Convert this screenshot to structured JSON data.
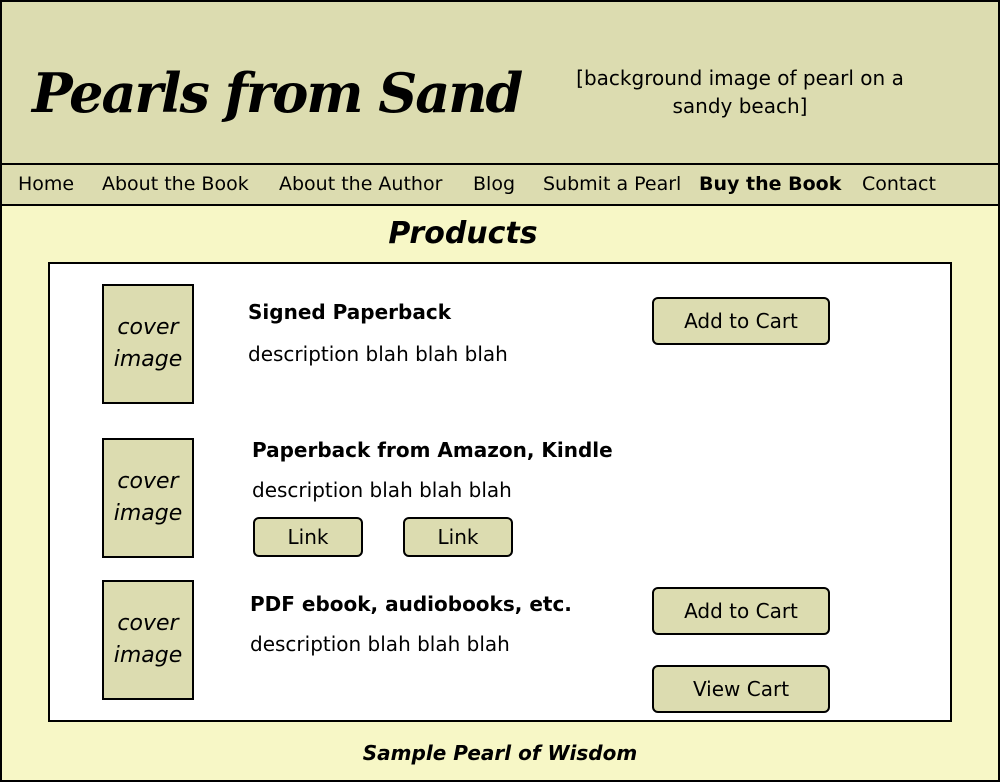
{
  "header": {
    "site_title": "Pearls from Sand",
    "background_note": "[background image of pearl on a sandy beach]"
  },
  "nav": {
    "items": [
      {
        "label": "Home"
      },
      {
        "label": "About the Book"
      },
      {
        "label": "About the Author"
      },
      {
        "label": "Blog"
      },
      {
        "label": "Submit a Pearl"
      },
      {
        "label": "Buy the Book",
        "active": true
      },
      {
        "label": "Contact"
      }
    ]
  },
  "main": {
    "heading": "Products",
    "products": [
      {
        "cover_text": "cover image",
        "title": "Signed Paperback",
        "description": "description blah blah blah",
        "buttons": [
          "Add to Cart"
        ]
      },
      {
        "cover_text": "cover image",
        "title": "Paperback from Amazon, Kindle",
        "description": "description blah blah blah",
        "buttons": [
          "Link",
          "Link"
        ]
      },
      {
        "cover_text": "cover image",
        "title": "PDF ebook, audiobooks, etc.",
        "description": "description blah blah blah",
        "buttons": [
          "Add to Cart",
          "View Cart"
        ]
      }
    ]
  },
  "footer": {
    "wisdom": "Sample Pearl of Wisdom"
  },
  "colors": {
    "header_bg": "#dcdcb0",
    "page_bg": "#f7f7c6",
    "panel_bg": "#ffffff",
    "border": "#000000"
  }
}
